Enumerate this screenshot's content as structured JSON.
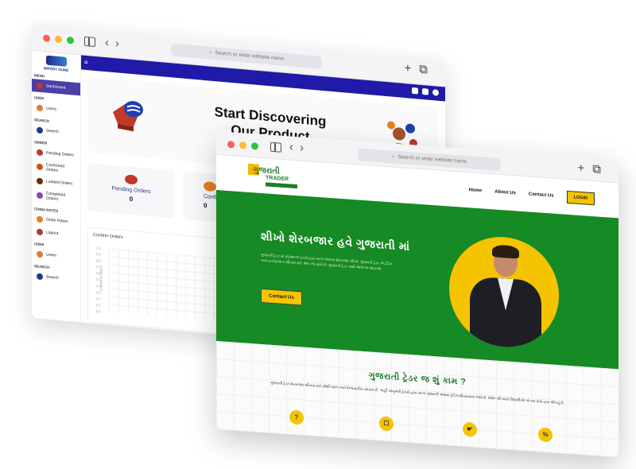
{
  "back_window": {
    "url_bar": "Search or enter website name",
    "logo_text": "IMPORT DUNE",
    "sidebar": [
      {
        "type": "section",
        "label": "MENU"
      },
      {
        "type": "item",
        "label": "Dashboard",
        "active": true,
        "color": "#c0392b"
      },
      {
        "type": "section",
        "label": "USER"
      },
      {
        "type": "item",
        "label": "Users",
        "color": "#e07b39"
      },
      {
        "type": "section",
        "label": "SEARCH"
      },
      {
        "type": "item",
        "label": "Search",
        "color": "#1e3a8a"
      },
      {
        "type": "section",
        "label": "ORDER"
      },
      {
        "type": "item",
        "label": "Pending Orders",
        "color": "#c0392b"
      },
      {
        "type": "item",
        "label": "Confirmed Orders",
        "color": "#d35400"
      },
      {
        "type": "item",
        "label": "Loaded Orders",
        "color": "#6e2c00"
      },
      {
        "type": "item",
        "label": "Completed Orders",
        "color": "#8e44ad"
      },
      {
        "type": "section",
        "label": "CHINA RATES"
      },
      {
        "type": "item",
        "label": "Order Rates",
        "color": "#e67e22"
      },
      {
        "type": "item",
        "label": "Logout",
        "color": "#b03a2e"
      },
      {
        "type": "section",
        "label": "USER"
      },
      {
        "type": "item",
        "label": "Users",
        "color": "#e07b39"
      },
      {
        "type": "section",
        "label": "SEARCH"
      },
      {
        "type": "item",
        "label": "Search",
        "color": "#1e3a8a"
      }
    ],
    "hero_title": "Start Discovering Our Product",
    "stats": [
      {
        "label": "Pending Orders",
        "value": "0"
      },
      {
        "label": "Confirme",
        "value": "0"
      }
    ],
    "chart_card": {
      "title": "Confirm Orders",
      "y_ticks": [
        "1.0",
        "0.9",
        "0.8",
        "0.7",
        "0.6",
        "0.5",
        "0.4",
        "0.3",
        "0.2",
        "0.1",
        "0.0"
      ],
      "y_label": "Number of Orders"
    }
  },
  "front_window": {
    "url_bar": "Search or enter website name",
    "logo": {
      "line1": "ગુજરાતી",
      "line2": "TRADER"
    },
    "nav": {
      "home": "Home",
      "about": "About Us",
      "contact": "Contact Us",
      "login": "LOGIN"
    },
    "hero": {
      "title": "શીખો શેરબજાર હવે ગુજરાતી માં",
      "paragraph": "ગુજરાતી ટ્રેડર માં પ્રોફેશનલ ટ્રેનર્સ દ્વારા સરળ ભાષામાં શેરબજાર શીખો. ગુજરાતી ટ્રેડર એ ટ્રેડિંગ અને ઇન્વેસ્ટમેન્ટ શીખવા માટે શ્રેષ્ઠ પ્લેટફોર્મ છે. ગુજરાતી ટ્રેડર સાથે આજે જ જોડાઓ.",
      "button": "Contact Us"
    },
    "section": {
      "title": "ગુજરાતી ટ્રેડર જ શું કામ ?",
      "paragraph": "ગુજરાતી ટ્રેડર શેરબજાર શીખવા માટે સૌથી સરળ અને વિશ્વસનીય માધ્યમ છે. અહીં અનુભવી ટ્રેનર્સ દ્વારા સરળ ગુજરાતી ભાષામાં ટ્રેડિંગ શીખવવામાં આવે છે. 200+ થી વધારે વિદ્યાર્થીઓ એ આ કોર્સ દ્વારા શીખ્યું છે."
    },
    "features": [
      "?",
      "☐",
      "☛",
      "%"
    ]
  }
}
